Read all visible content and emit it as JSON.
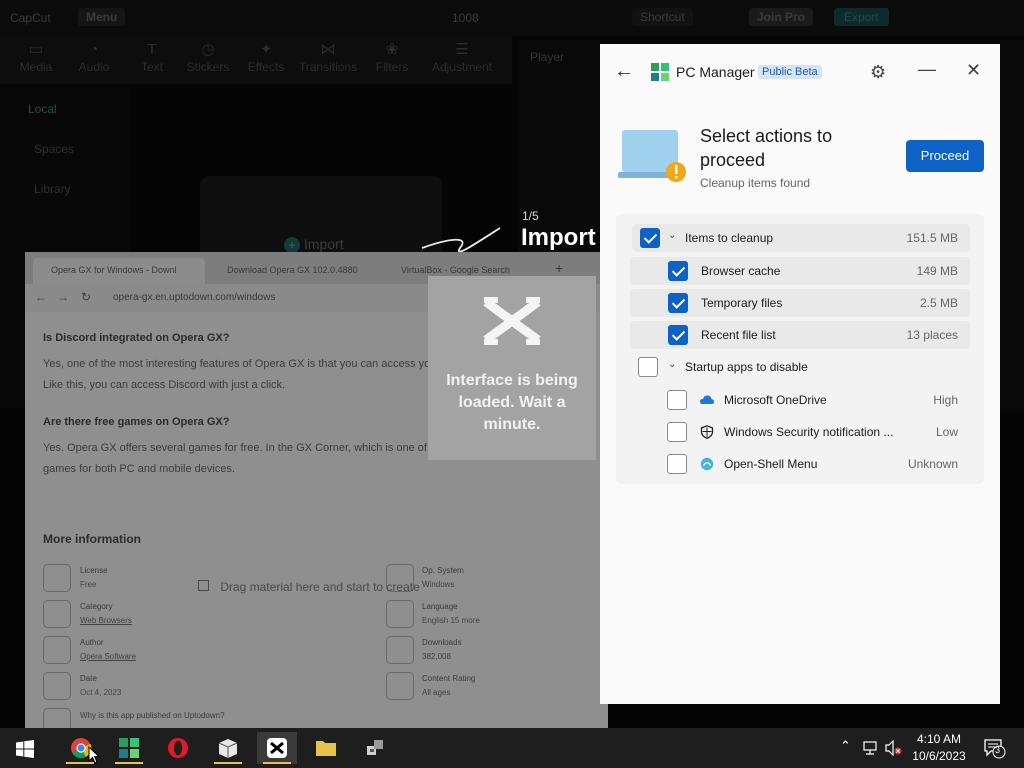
{
  "capcut": {
    "logo": "CapCut",
    "menu": "Menu",
    "project": "1008",
    "shortcut": "Shortcut",
    "join_pro": "Join Pro",
    "export": "Export",
    "tools": [
      "Media",
      "Audio",
      "Text",
      "Stickers",
      "Effects",
      "Transitions",
      "Filters",
      "Adjustment"
    ],
    "left_nav": [
      "Local",
      "Spaces",
      "Library"
    ],
    "import_label": "Import",
    "player_label": "Player",
    "drag_hint": "Drag material here and start to create",
    "tour_step": "1/5",
    "tour_title": "Import",
    "loading_text": "Interface is being loaded. Wait a minute."
  },
  "browser": {
    "tabs": [
      "Opera GX for Windows - Downl",
      "Download Opera GX 102.0.4880",
      "VirtualBox - Google Search"
    ],
    "url": "opera-gx.en.uptodown.com/windows",
    "q1": "Is Discord integrated on Opera GX?",
    "a1_line1": "Yes, one of the most interesting features of Opera GX is that you can access your Discord account from one of t",
    "a1_line2": "Like this, you can access Discord with just a click.",
    "q2": "Are there free games on Opera GX?",
    "a2_line1": "Yes. Opera GX offers several games for free. In the GX Corner, which is one of the browser's features, you'll find",
    "a2_line2": "games for both PC and mobile devices.",
    "more_info": "More information",
    "info_left": [
      {
        "label": "License",
        "value": "Free"
      },
      {
        "label": "Category",
        "value": "Web Browsers"
      },
      {
        "label": "Author",
        "value": "Opera Software"
      },
      {
        "label": "Date",
        "value": "Oct 4, 2023"
      }
    ],
    "info_right": [
      {
        "label": "Op. System",
        "value": "Windows"
      },
      {
        "label": "Language",
        "value": "English 15 more"
      },
      {
        "label": "Downloads",
        "value": "382,008"
      },
      {
        "label": "Content Rating",
        "value": "All ages"
      }
    ],
    "why_published": "Why is this app published on Uptodown?"
  },
  "pc_manager": {
    "title": "PC Manager",
    "badge": "Public Beta",
    "heading": "Select actions to proceed",
    "subheading": "Cleanup items found",
    "proceed": "Proceed",
    "cleanup_group": {
      "label": "Items to cleanup",
      "value": "151.5 MB",
      "checked": true
    },
    "cleanup_items": [
      {
        "label": "Browser cache",
        "value": "149 MB",
        "checked": true
      },
      {
        "label": "Temporary files",
        "value": "2.5 MB",
        "checked": true
      },
      {
        "label": "Recent file list",
        "value": "13 places",
        "checked": true
      }
    ],
    "startup_group": {
      "label": "Startup apps to disable",
      "checked": false
    },
    "startup_items": [
      {
        "label": "Microsoft OneDrive",
        "value": "High",
        "icon": "onedrive-icon",
        "checked": false
      },
      {
        "label": "Windows Security notification ...",
        "value": "Low",
        "icon": "shield-icon",
        "checked": false
      },
      {
        "label": "Open-Shell Menu",
        "value": "Unknown",
        "icon": "open-shell-icon",
        "checked": false
      }
    ]
  },
  "taskbar": {
    "time": "4:10 AM",
    "date": "10/6/2023",
    "notifications": "3"
  }
}
